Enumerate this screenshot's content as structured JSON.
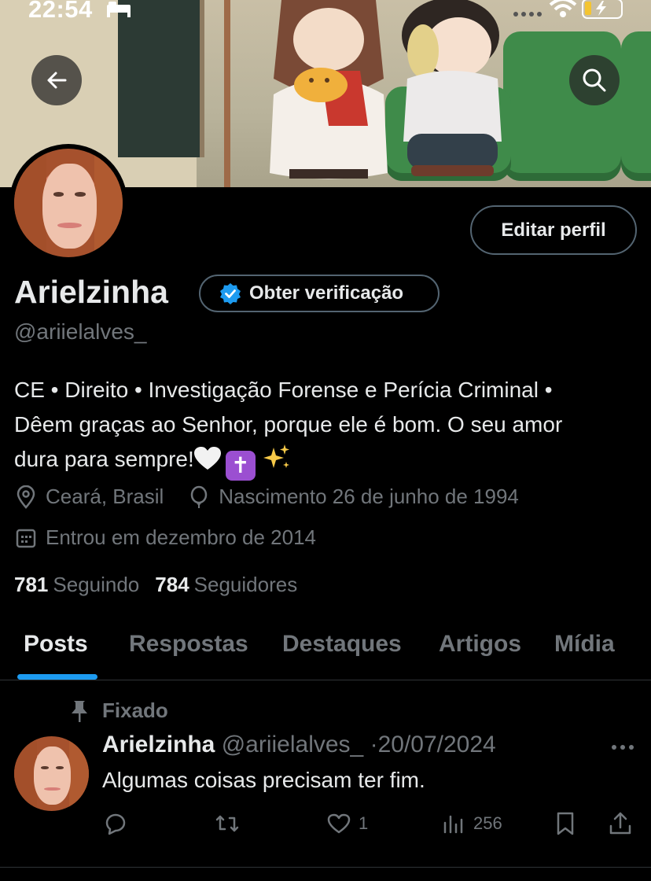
{
  "status_bar": {
    "time": "22:54"
  },
  "profile": {
    "name": "Arielzinha",
    "handle": "@ariielalves_",
    "edit_button": "Editar perfil",
    "verify_button": "Obter verificação",
    "bio_line1": "CE • Direito • Investigação Forense e Perícia Criminal •",
    "bio_line2": "Dêem graças ao Senhor, porque ele é bom. O seu amor",
    "bio_line3": "dura para sempre!",
    "location": "Ceará, Brasil",
    "birthday": "Nascimento 26 de junho de 1994",
    "joined": "Entrou em dezembro de 2014",
    "following_count": "781",
    "following_label": "Seguindo",
    "followers_count": "784",
    "followers_label": "Seguidores"
  },
  "tabs": [
    {
      "label": "Posts",
      "active": true
    },
    {
      "label": "Respostas",
      "active": false
    },
    {
      "label": "Destaques",
      "active": false
    },
    {
      "label": "Artigos",
      "active": false
    },
    {
      "label": "Mídia",
      "active": false
    }
  ],
  "pinned_post": {
    "pinned_label": "Fixado",
    "author_name": "Arielzinha",
    "author_handle": "@ariielalves_",
    "separator": "·",
    "date": "20/07/2024",
    "text": "Algumas coisas precisam ter fim.",
    "likes": "1",
    "views": "256"
  },
  "colors": {
    "accent": "#1d9bf0",
    "muted": "#71767b",
    "text": "#e7e9ea",
    "background": "#000000"
  },
  "icons": [
    "back-arrow-icon",
    "search-icon",
    "verified-badge-icon",
    "location-icon",
    "balloon-icon",
    "calendar-icon",
    "pin-icon",
    "more-icon",
    "reply-icon",
    "repost-icon",
    "like-icon",
    "views-icon",
    "bookmark-icon",
    "share-icon"
  ]
}
